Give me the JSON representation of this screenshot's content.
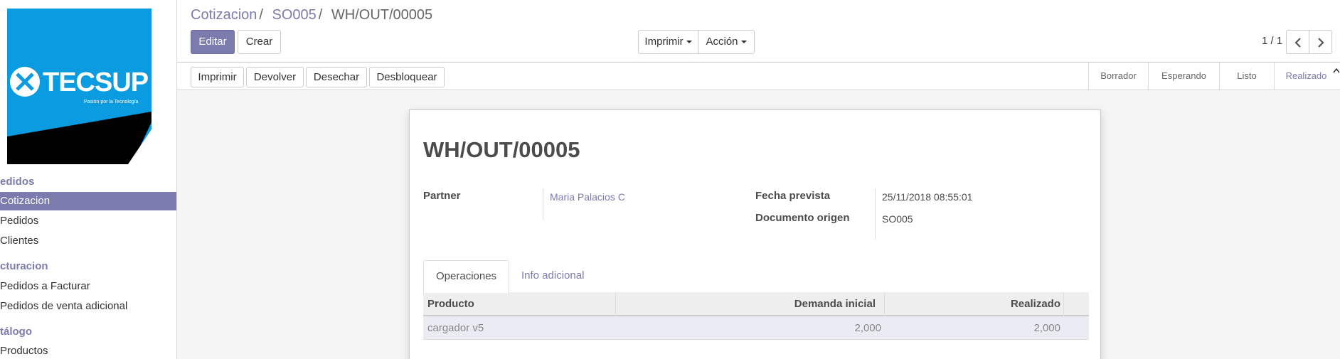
{
  "sidebar": {
    "logo_text": "TECSUP",
    "logo_tagline": "Pasión por la Tecnología",
    "sections": [
      {
        "title": "edidos",
        "items": [
          {
            "label": "Cotizacion",
            "active": true
          },
          {
            "label": "Pedidos",
            "active": false
          },
          {
            "label": "Clientes",
            "active": false
          }
        ]
      },
      {
        "title": "cturacion",
        "items": [
          {
            "label": "Pedidos a Facturar",
            "active": false
          },
          {
            "label": "Pedidos de venta adicional",
            "active": false
          }
        ]
      },
      {
        "title": "tálogo",
        "items": [
          {
            "label": "Productos",
            "active": false
          }
        ]
      }
    ]
  },
  "breadcrumb": {
    "items": [
      "Cotizacion",
      "SO005"
    ],
    "separator": "/",
    "current": "WH/OUT/00005"
  },
  "toolbar": {
    "edit_label": "Editar",
    "create_label": "Crear",
    "print_label": "Imprimir",
    "action_label": "Acción"
  },
  "pager": {
    "value": "1 / 1",
    "prev_icon": "chevron-left-icon",
    "next_icon": "chevron-right-icon"
  },
  "statusbar": {
    "buttons": [
      "Imprimir",
      "Devolver",
      "Desechar",
      "Desbloquear"
    ],
    "stages": [
      {
        "label": "Borrador",
        "active": false
      },
      {
        "label": "Esperando",
        "active": false
      },
      {
        "label": "Listo",
        "active": false
      },
      {
        "label": "Realizado",
        "active": true
      }
    ]
  },
  "form": {
    "title": "WH/OUT/00005",
    "partner_label": "Partner",
    "partner_value": "Maria Palacios C",
    "scheduled_label": "Fecha prevista",
    "scheduled_value": "25/11/2018 08:55:01",
    "origin_label": "Documento origen",
    "origin_value": "SO005",
    "tabs": [
      {
        "label": "Operaciones",
        "active": true
      },
      {
        "label": "Info adicional",
        "active": false
      }
    ],
    "table": {
      "columns": [
        "Producto",
        "Demanda inicial",
        "Realizado"
      ],
      "rows": [
        {
          "product": "cargador v5",
          "demand": "2,000",
          "done": "2,000"
        }
      ]
    }
  },
  "colors": {
    "accent": "#7c7bad",
    "logo_bg": "#0b9be0"
  }
}
